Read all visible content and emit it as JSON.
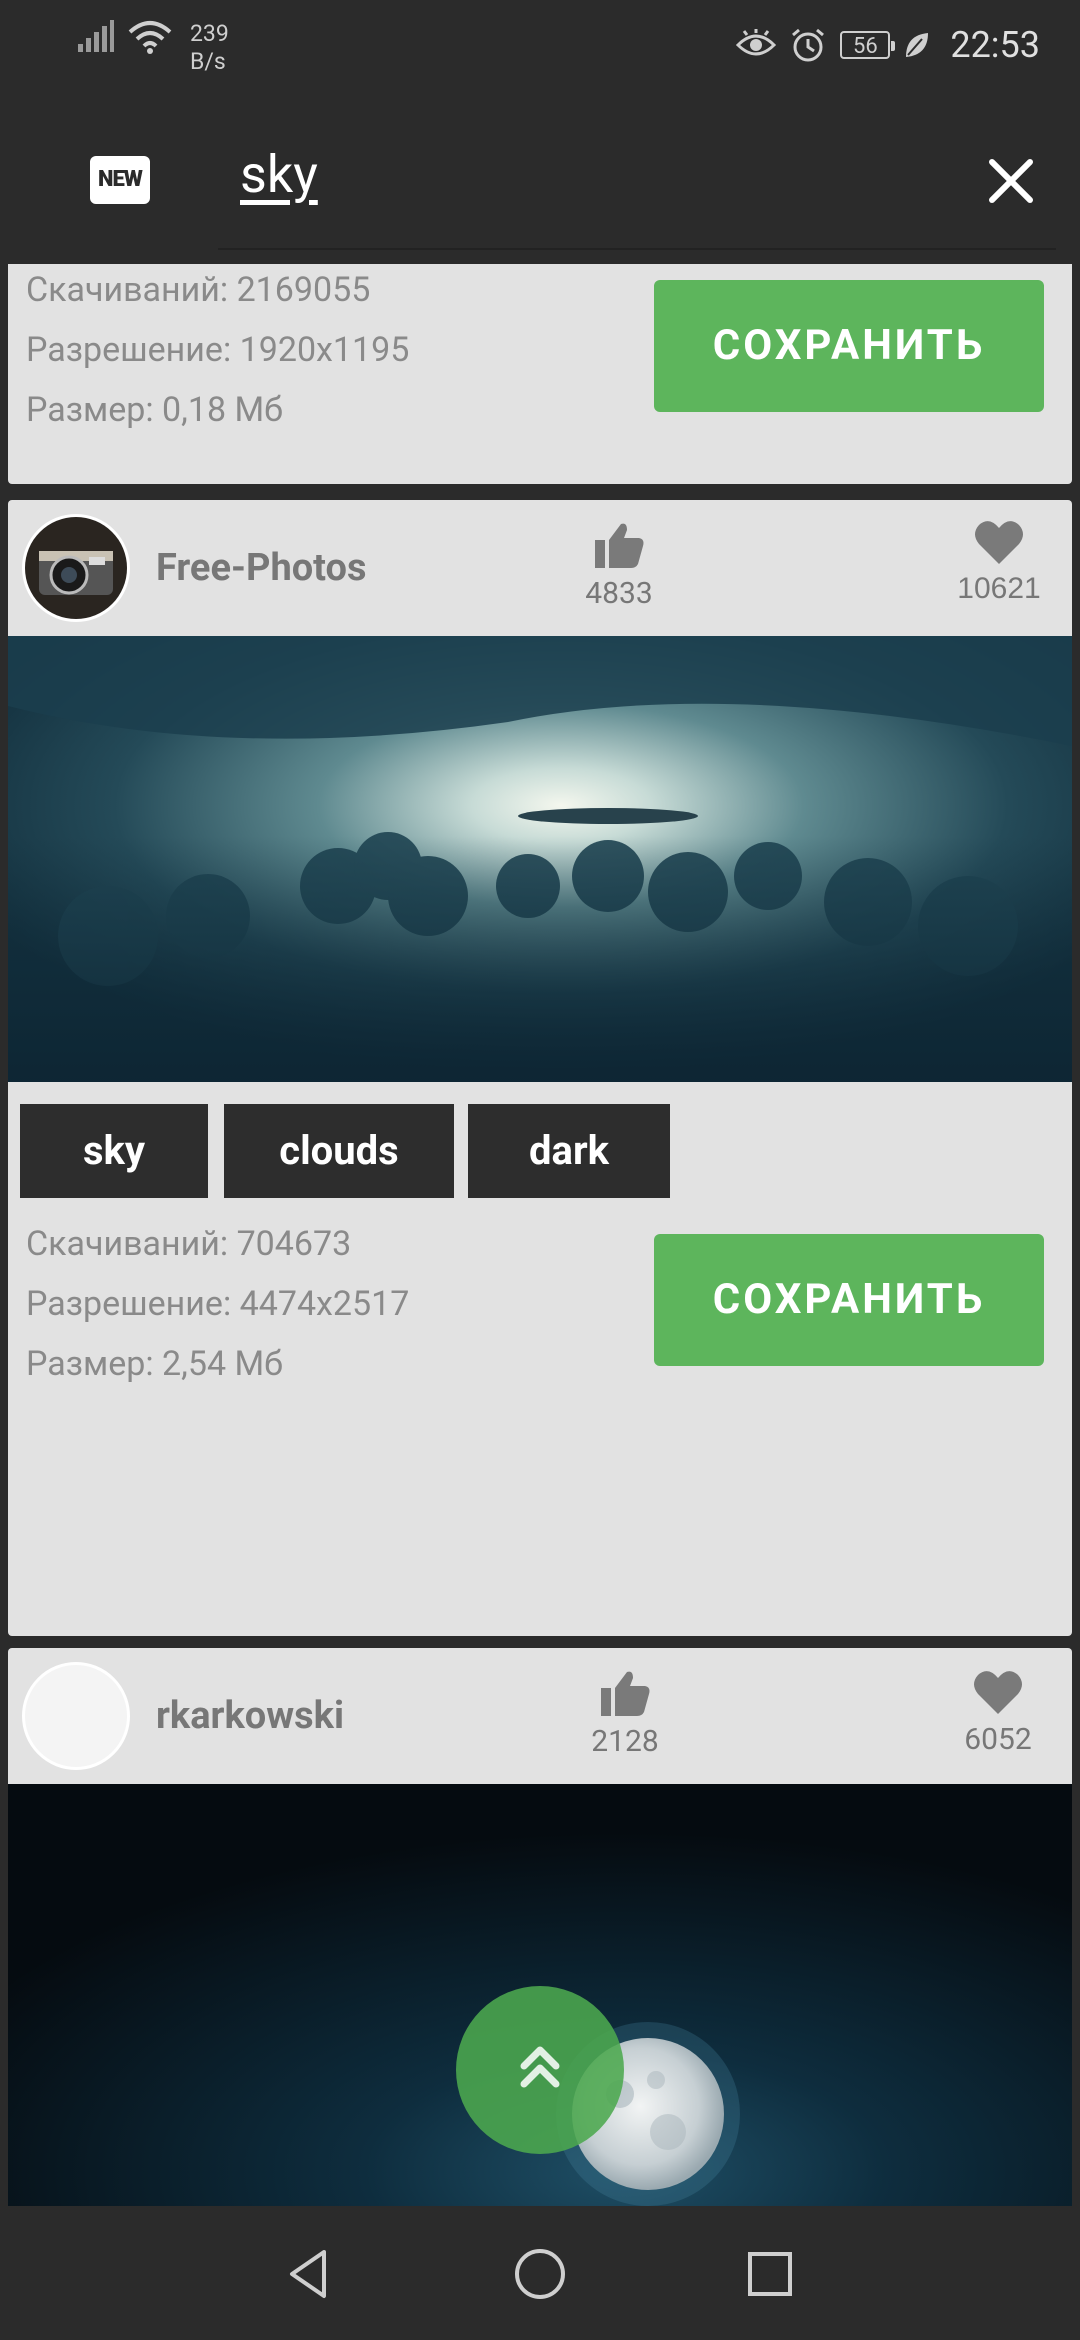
{
  "status_bar": {
    "net_speed_value": "239",
    "net_speed_unit": "B/s",
    "battery": "56",
    "time": "22:53"
  },
  "toolbar": {
    "badge": "NEW",
    "search_query": "sky"
  },
  "cards": [
    {
      "downloads": "Скачиваний: 2169055",
      "resolution": "Разрешение: 1920x1195",
      "size": "Размер: 0,18 Мб",
      "save_label": "СОХРАНИТЬ"
    },
    {
      "author": "Free-Photos",
      "likes": "4833",
      "favorites": "10621",
      "tags": [
        "sky",
        "clouds",
        "dark"
      ],
      "downloads": "Скачиваний: 704673",
      "resolution": "Разрешение: 4474x2517",
      "size": "Размер: 2,54 Мб",
      "save_label": "СОХРАНИТЬ"
    },
    {
      "author": "rkarkowski",
      "likes": "2128",
      "favorites": "6052"
    }
  ],
  "icons": {
    "like": "thumb-up-icon",
    "favorite": "heart-icon",
    "scroll_top": "double-chevron-up-icon",
    "close": "close-icon"
  },
  "colors": {
    "accent": "#5db55c",
    "background": "#2b2b2b",
    "card": "#e2e2e2"
  }
}
